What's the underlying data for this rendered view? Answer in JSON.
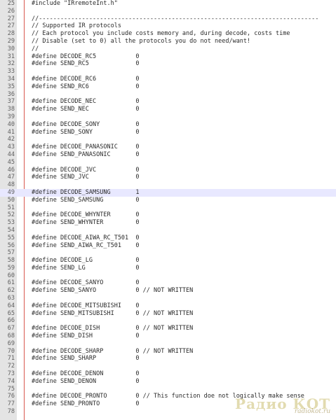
{
  "editor": {
    "current_line": "49",
    "lines": [
      {
        "num": "25",
        "code": "#include \"IRremoteInt.h\""
      },
      {
        "num": "26",
        "code": ""
      },
      {
        "num": "27",
        "code": "//------------------------------------------------------------------------------"
      },
      {
        "num": "27",
        "code": "// Supported IR protocols"
      },
      {
        "num": "28",
        "code": "// Each protocol you include costs memory and, during decode, costs time"
      },
      {
        "num": "29",
        "code": "// Disable (set to 0) all the protocols you do not need/want!"
      },
      {
        "num": "30",
        "code": "//"
      },
      {
        "num": "31",
        "code": "#define DECODE_RC5           0"
      },
      {
        "num": "32",
        "code": "#define SEND_RC5             0"
      },
      {
        "num": "33",
        "code": ""
      },
      {
        "num": "34",
        "code": "#define DECODE_RC6           0"
      },
      {
        "num": "35",
        "code": "#define SEND_RC6             0"
      },
      {
        "num": "36",
        "code": ""
      },
      {
        "num": "37",
        "code": "#define DECODE_NEC           0"
      },
      {
        "num": "38",
        "code": "#define SEND_NEC             0"
      },
      {
        "num": "39",
        "code": ""
      },
      {
        "num": "40",
        "code": "#define DECODE_SONY          0"
      },
      {
        "num": "41",
        "code": "#define SEND_SONY            0"
      },
      {
        "num": "42",
        "code": ""
      },
      {
        "num": "43",
        "code": "#define DECODE_PANASONIC     0"
      },
      {
        "num": "44",
        "code": "#define SEND_PANASONIC       0"
      },
      {
        "num": "45",
        "code": ""
      },
      {
        "num": "46",
        "code": "#define DECODE_JVC           0"
      },
      {
        "num": "47",
        "code": "#define SEND_JVC             0"
      },
      {
        "num": "48",
        "code": ""
      },
      {
        "num": "49",
        "code": "#define DECODE_SAMSUNG       1"
      },
      {
        "num": "50",
        "code": "#define SEND_SAMSUNG         0"
      },
      {
        "num": "51",
        "code": ""
      },
      {
        "num": "52",
        "code": "#define DECODE_WHYNTER       0"
      },
      {
        "num": "53",
        "code": "#define SEND_WHYNTER         0"
      },
      {
        "num": "54",
        "code": ""
      },
      {
        "num": "55",
        "code": "#define DECODE_AIWA_RC_T501  0"
      },
      {
        "num": "56",
        "code": "#define SEND_AIWA_RC_T501    0"
      },
      {
        "num": "57",
        "code": ""
      },
      {
        "num": "58",
        "code": "#define DECODE_LG            0"
      },
      {
        "num": "59",
        "code": "#define SEND_LG              0"
      },
      {
        "num": "60",
        "code": ""
      },
      {
        "num": "61",
        "code": "#define DECODE_SANYO         0"
      },
      {
        "num": "62",
        "code": "#define SEND_SANYO           0 // NOT WRITTEN"
      },
      {
        "num": "63",
        "code": ""
      },
      {
        "num": "64",
        "code": "#define DECODE_MITSUBISHI    0"
      },
      {
        "num": "65",
        "code": "#define SEND_MITSUBISHI      0 // NOT WRITTEN"
      },
      {
        "num": "66",
        "code": ""
      },
      {
        "num": "67",
        "code": "#define DECODE_DISH          0 // NOT WRITTEN"
      },
      {
        "num": "68",
        "code": "#define SEND_DISH            0"
      },
      {
        "num": "69",
        "code": ""
      },
      {
        "num": "70",
        "code": "#define DECODE_SHARP         0 // NOT WRITTEN"
      },
      {
        "num": "71",
        "code": "#define SEND_SHARP           0"
      },
      {
        "num": "72",
        "code": ""
      },
      {
        "num": "73",
        "code": "#define DECODE_DENON         0"
      },
      {
        "num": "74",
        "code": "#define SEND_DENON           0"
      },
      {
        "num": "75",
        "code": ""
      },
      {
        "num": "76",
        "code": "#define DECODE_PRONTO        0 // This function doe not logically make sense"
      },
      {
        "num": "77",
        "code": "#define SEND_PRONTO          0"
      },
      {
        "num": "78",
        "code": ""
      }
    ]
  },
  "watermark": {
    "title": "Радио КОТ",
    "site": "radiokot.ru"
  }
}
